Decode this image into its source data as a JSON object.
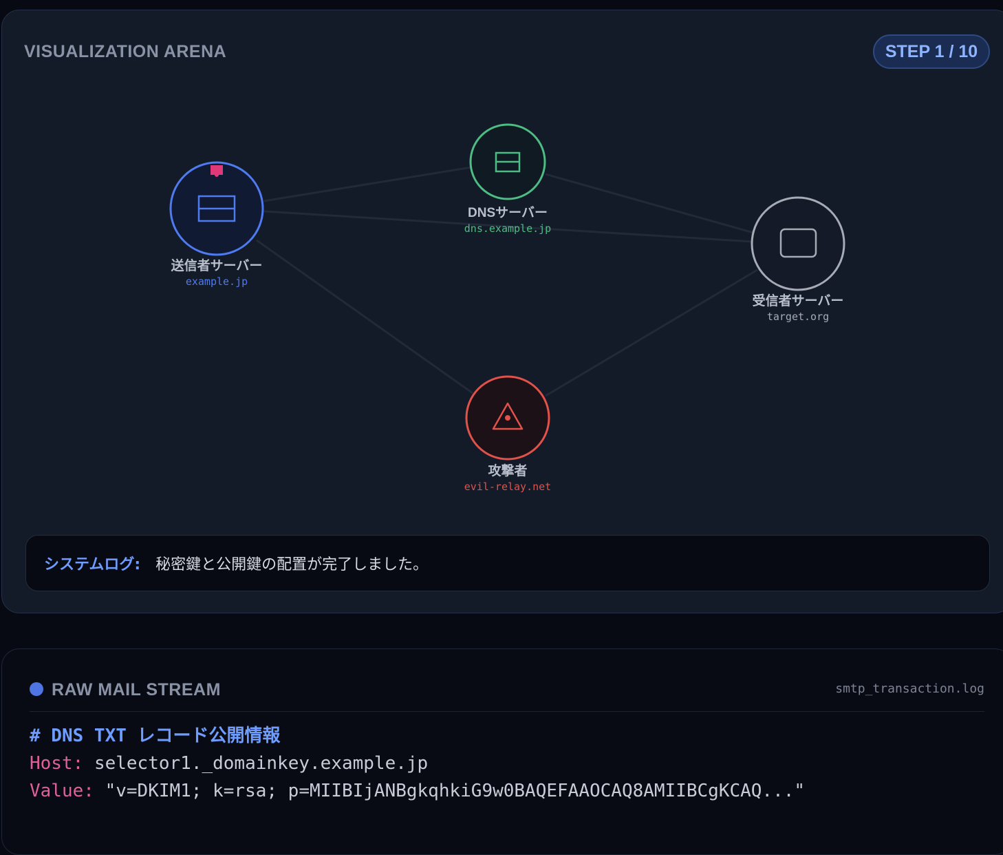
{
  "arena": {
    "title": "VISUALIZATION ARENA",
    "step": "STEP 1 / 10"
  },
  "nodes": {
    "sender": {
      "name": "送信者サーバー",
      "host": "example.jp",
      "color": "#4f7bf0",
      "icon": "server-icon"
    },
    "dns": {
      "name": "DNSサーバー",
      "host": "dns.example.jp",
      "color": "#4ebd84",
      "icon": "server-icon"
    },
    "receiver": {
      "name": "受信者サーバー",
      "host": "target.org",
      "color": "#a6abb5",
      "icon": "inbox-icon"
    },
    "attacker": {
      "name": "攻撃者",
      "host": "evil-relay.net",
      "color": "#e0524a",
      "icon": "warning-triangle-icon"
    }
  },
  "key_marker_color": "#e0397a",
  "log": {
    "label": "システムログ:",
    "message": "秘密鍵と公開鍵の配置が完了しました。"
  },
  "stream": {
    "title": "RAW MAIL STREAM",
    "file": "smtp_transaction.log",
    "comment": "# DNS TXT レコード公開情報",
    "host_key": "Host:",
    "host_value": "selector1._domainkey.example.jp",
    "value_key": "Value:",
    "value_value": "\"v=DKIM1; k=rsa; p=MIIBIjANBgkqhkiG9w0BAQEFAAOCAQ8AMIIBCgKCAQ...\""
  }
}
